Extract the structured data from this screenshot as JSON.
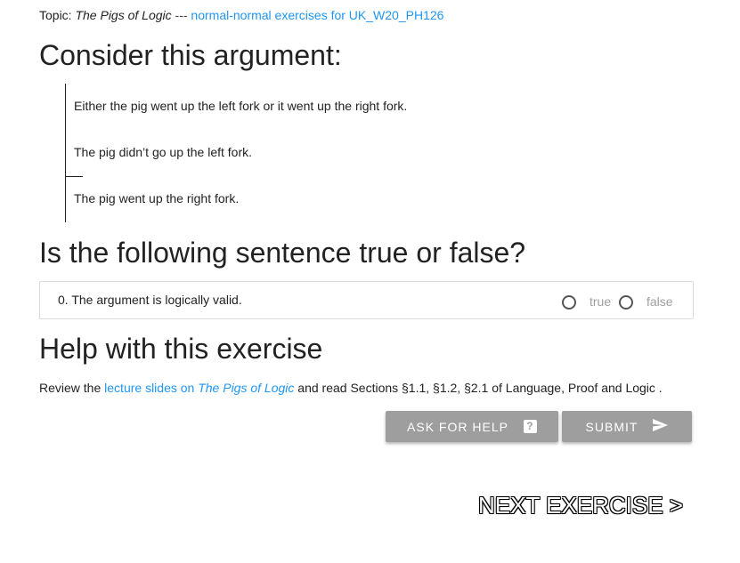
{
  "topic": {
    "prefix": "Topic:",
    "title": "The Pigs of Logic",
    "dash": "---",
    "link": "normal-normal exercises for UK_W20_PH126"
  },
  "heading_consider": "Consider this argument:",
  "argument": {
    "premises": [
      "Either the pig went up the left fork or it went up the right fork.",
      "The pig didn’t go up the left fork."
    ],
    "conclusion": "The pig went up the right fork."
  },
  "heading_question": "Is the following sentence true or false?",
  "question": {
    "text": "0. The argument is logically valid.",
    "options": [
      "true",
      "false"
    ]
  },
  "heading_help": "Help with this exercise",
  "help": {
    "review": "Review the",
    "slides_link": "lecture slides on",
    "slides_title": "The Pigs of Logic",
    "read": "and read Sections §1.1, §1.2, §2.1 of Language, Proof and Logic ."
  },
  "buttons": {
    "ask_for_help": "ASK FOR HELP",
    "ask_icon": "?",
    "submit": "SUBMIT"
  },
  "next_exercise": "NEXT EXERCISE >",
  "colors": {
    "link": "#2196f3",
    "button": "#9e9e9e",
    "option_label": "#9e9e9e"
  },
  "icons": {
    "help": "help-icon",
    "submit": "send-icon"
  }
}
